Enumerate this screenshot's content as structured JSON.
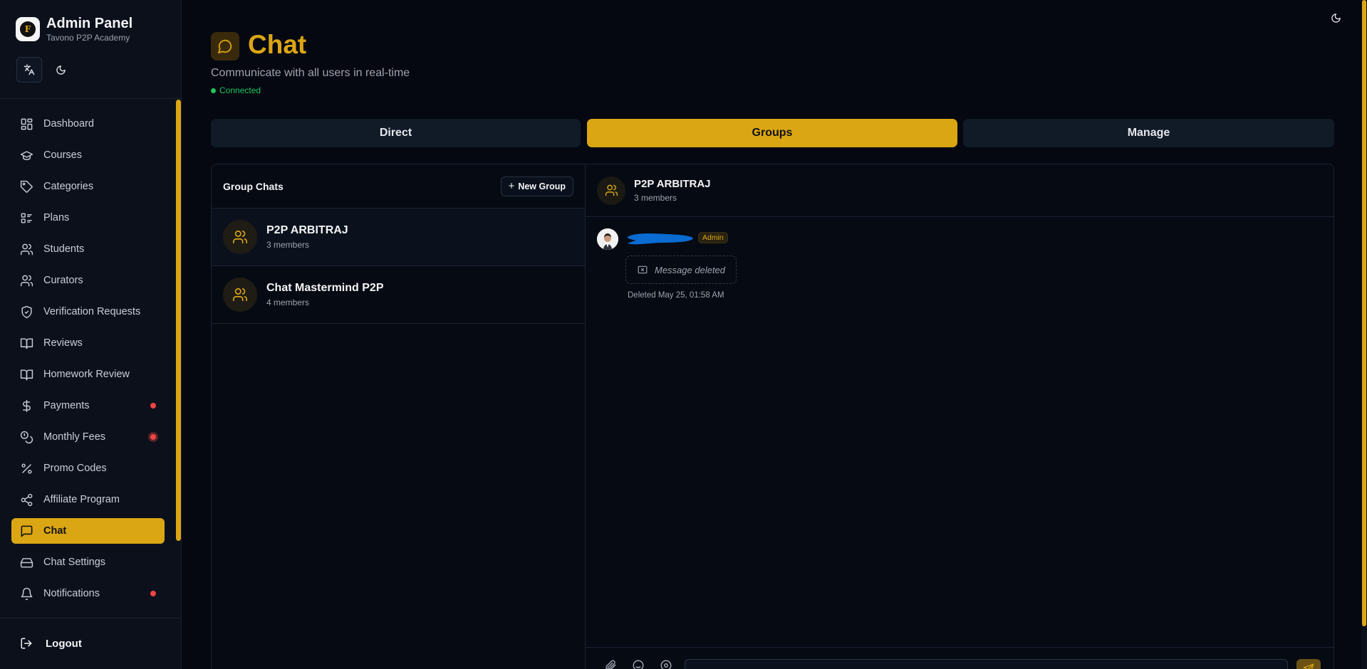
{
  "sidebar": {
    "brand_title": "Admin Panel",
    "brand_sub": "Tavono P2P Academy",
    "brand_logo_letter": "F",
    "items": [
      {
        "label": "Dashboard",
        "icon": "dashboard-icon"
      },
      {
        "label": "Courses",
        "icon": "graduation-cap-icon"
      },
      {
        "label": "Categories",
        "icon": "tag-icon"
      },
      {
        "label": "Plans",
        "icon": "list-icon"
      },
      {
        "label": "Students",
        "icon": "users-icon"
      },
      {
        "label": "Curators",
        "icon": "users-icon"
      },
      {
        "label": "Verification Requests",
        "icon": "shield-check-icon"
      },
      {
        "label": "Reviews",
        "icon": "book-icon"
      },
      {
        "label": "Homework Review",
        "icon": "book-icon"
      },
      {
        "label": "Payments",
        "icon": "dollar-icon"
      },
      {
        "label": "Monthly Fees",
        "icon": "coins-icon"
      },
      {
        "label": "Promo Codes",
        "icon": "percent-icon"
      },
      {
        "label": "Affiliate Program",
        "icon": "share-icon"
      },
      {
        "label": "Chat",
        "icon": "chat-icon"
      },
      {
        "label": "Chat Settings",
        "icon": "drive-icon"
      },
      {
        "label": "Notifications",
        "icon": "bell-icon"
      }
    ],
    "logout_label": "Logout"
  },
  "header": {
    "title": "Chat",
    "subtitle": "Communicate with all users in real-time",
    "status": "Connected"
  },
  "tabs": [
    "Direct",
    "Groups",
    "Manage"
  ],
  "groups": {
    "title": "Group Chats",
    "new_group_label": "New Group",
    "items": [
      {
        "name": "P2P ARBITRAJ",
        "members": "3 members"
      },
      {
        "name": "Chat Mastermind P2P",
        "members": "4 members"
      }
    ]
  },
  "chat": {
    "name": "P2P ARBITRAJ",
    "members": "3 members",
    "message": {
      "badge": "Admin",
      "text": "Message deleted",
      "deleted_at": "Deleted May 25, 01:58 AM"
    }
  },
  "colors": {
    "accent": "#dba614",
    "background": "#050811",
    "sidebar": "#0b101b",
    "status_green": "#22c55e",
    "alert_red": "#ef4444"
  }
}
